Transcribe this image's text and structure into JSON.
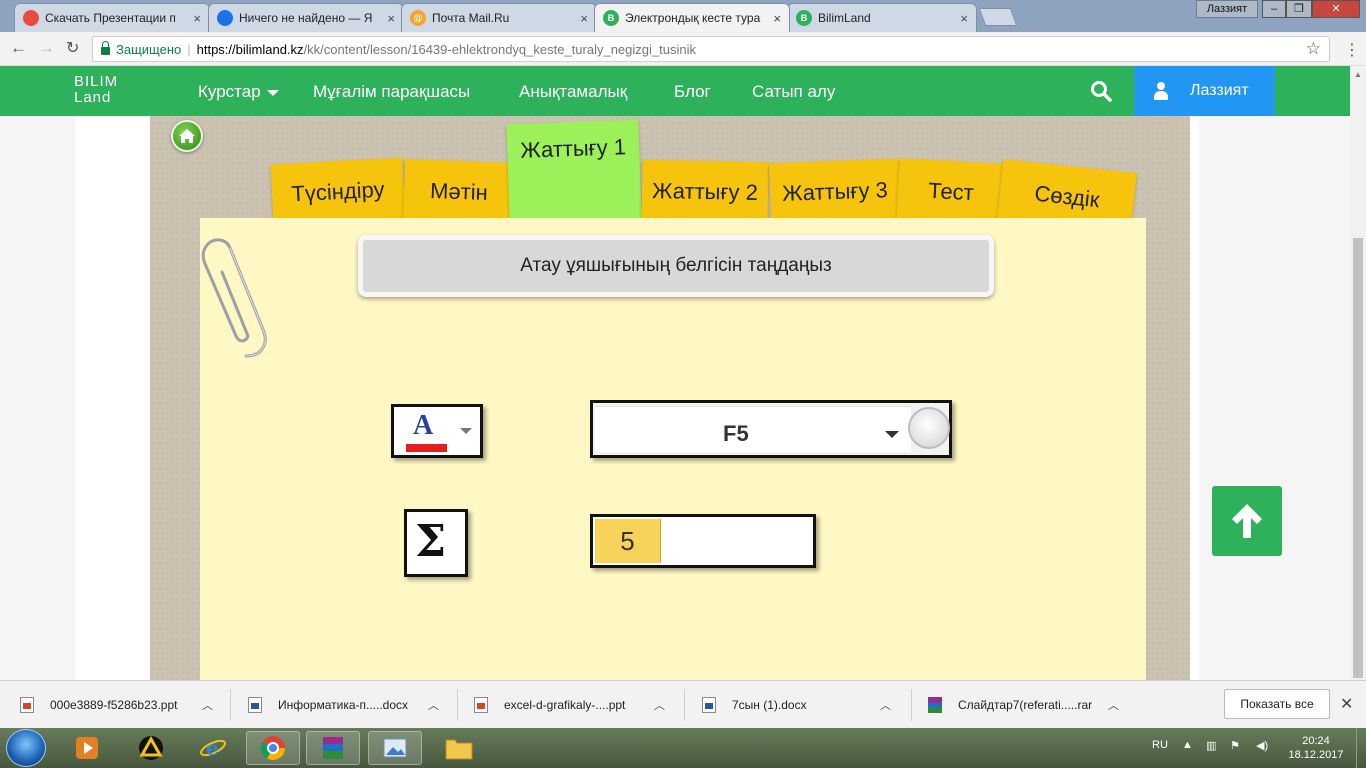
{
  "browser": {
    "tabs": [
      {
        "title": "Скачать Презентации п",
        "active": false,
        "favicon_color": "#e74c3c"
      },
      {
        "title": "Ничего не найдено — Я",
        "active": false,
        "favicon_color": "#1a73e8"
      },
      {
        "title": "Почта Mail.Ru",
        "active": false,
        "favicon_color": "#f5a623"
      },
      {
        "title": "Электрондық кесте тура",
        "active": true,
        "favicon_color": "#2eb15b"
      },
      {
        "title": "BilimLand",
        "active": false,
        "favicon_color": "#2eb15b"
      }
    ],
    "window_user": "Лаззият",
    "secure_label": "Защищено",
    "url_host": "https://bilimland.kz",
    "url_path": "/kk/content/lesson/16439-ehlektrondyq_keste_turaly_negizgi_tusinik"
  },
  "site": {
    "logo_line1": "BILIM",
    "logo_line2": "Land",
    "nav": [
      {
        "label": "Курстар",
        "has_dropdown": true
      },
      {
        "label": "Мұғалім парақшасы"
      },
      {
        "label": "Анықтамалық"
      },
      {
        "label": "Блог"
      },
      {
        "label": "Сатып алу"
      }
    ],
    "user_name": "Лаззият",
    "brand_green": "#2eb15b",
    "user_blue": "#2196f3"
  },
  "lesson": {
    "tabs": [
      {
        "label": "Түсіндіру",
        "active": false
      },
      {
        "label": "Мәтін",
        "active": false
      },
      {
        "label": "Жаттығу 1",
        "active": true
      },
      {
        "label": "Жаттығу 2",
        "active": false
      },
      {
        "label": "Жаттығу 3",
        "active": false
      },
      {
        "label": "Тест",
        "active": false
      },
      {
        "label": "Сөздік",
        "active": false
      }
    ],
    "question": "Атау ұяшығының белгісін таңдаңыз",
    "options": {
      "font_color_letter": "A",
      "name_box_value": "F5",
      "sigma_symbol": "Σ",
      "cell_value": "5"
    }
  },
  "downloads": {
    "items": [
      {
        "name": "000e3889-f5286b23.ppt",
        "type": "ppt"
      },
      {
        "name": "Информатика-п.....docx",
        "type": "doc"
      },
      {
        "name": "excel-d-grafikaly-....ppt",
        "type": "ppt"
      },
      {
        "name": "7сын (1).docx",
        "type": "doc"
      },
      {
        "name": "Слайдтар7(referati.....rar",
        "type": "rar"
      }
    ],
    "show_all": "Показать все"
  },
  "taskbar": {
    "lang": "RU",
    "time": "20:24",
    "date": "18.12.2017"
  }
}
